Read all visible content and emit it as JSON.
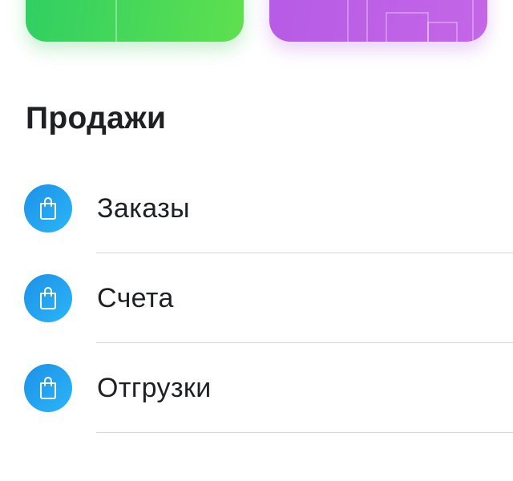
{
  "section": {
    "title": "Продажи"
  },
  "cards": {
    "left_color": "#3fd55a",
    "right_color": "#bb5fe6"
  },
  "list": {
    "items": [
      {
        "label": "Заказы",
        "icon": "shopping-bag-icon"
      },
      {
        "label": "Счета",
        "icon": "shopping-bag-icon"
      },
      {
        "label": "Отгрузки",
        "icon": "shopping-bag-icon"
      }
    ]
  },
  "colors": {
    "icon_circle": "#1f9bef",
    "text": "#1f2024",
    "divider": "#d7d8dc"
  }
}
